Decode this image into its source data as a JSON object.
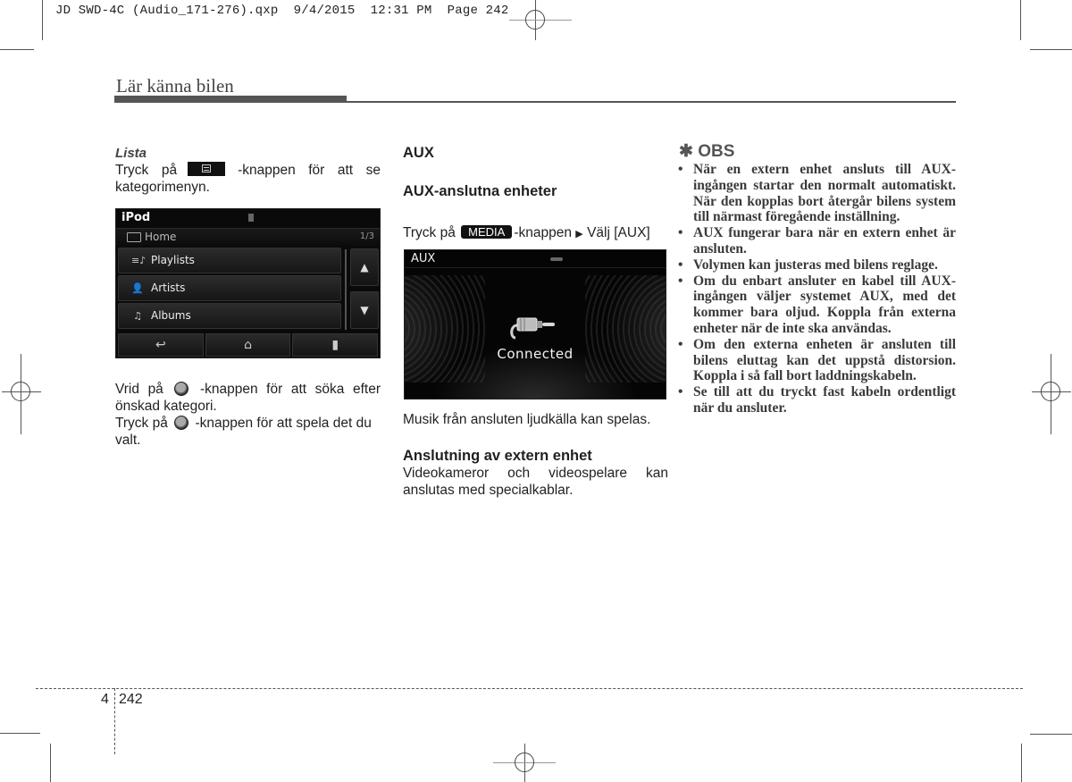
{
  "slug": "JD SWD-4C (Audio_171-276).qxp  9/4/2015  12:31 PM  Page 242",
  "running_head": "Lär känna bilen",
  "column1": {
    "heading": "Lista",
    "para1_before": "Tryck på",
    "para1_after": "-knappen för att se kategorimenyn.",
    "menu_button_icon": "list-menu-icon",
    "ipod_screen": {
      "title": "iPod",
      "path": "Home",
      "page": "1/3",
      "items": [
        {
          "icon": "playlist-icon",
          "label": "Playlists"
        },
        {
          "icon": "artist-icon",
          "label": "Artists"
        },
        {
          "icon": "album-icon",
          "label": "Albums"
        }
      ],
      "bottom_buttons": [
        "back-icon",
        "home-icon",
        "folder-up-icon"
      ],
      "arrows": [
        "up",
        "down"
      ]
    },
    "para2_before": "Vrid på",
    "para2_after": "-knappen för att söka efter önskad kategori.",
    "para3_before": "Tryck på",
    "para3_after": "-knappen för att spela det du valt."
  },
  "column2": {
    "heading": "AUX",
    "subheading": "AUX-anslutna enheter",
    "instruction_before": "Tryck på",
    "media_badge": "MEDIA",
    "instruction_after": "-knappen",
    "instruction_arrow": "▶",
    "instruction_end": "Välj [AUX]",
    "aux_screen": {
      "title": "AUX",
      "status": "Connected"
    },
    "para1": "Musik från ansluten ljudkälla kan spelas.",
    "subheading2": "Anslutning av extern enhet",
    "para2": "Videokameror och videospelare kan anslutas med specialkablar."
  },
  "column3": {
    "heading_symbol": "✱",
    "heading": "OBS",
    "notes": [
      "När en extern enhet ansluts till AUX-ingången startar den normalt automatiskt. När den kopplas bort återgår bilens system till närmast föregående inställning.",
      "AUX fungerar bara när en extern enhet är ansluten.",
      "Volymen kan justeras med bilens reglage.",
      "Om du enbart ansluter en kabel till AUX-ingången väljer systemet AUX, med det kommer bara oljud. Koppla från externa enheter när de inte ska användas.",
      "Om den externa enheten är ansluten till bilens eluttag kan det uppstå distorsion. Koppla i så fall bort laddningskabeln.",
      "Se till att du tryckt fast kabeln ordentligt när du ansluter."
    ]
  },
  "footer": {
    "chapter": "4",
    "page": "242"
  }
}
